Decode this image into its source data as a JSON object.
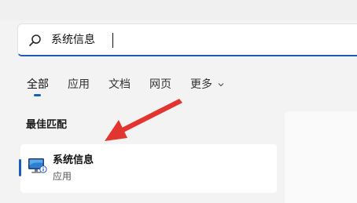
{
  "search": {
    "query": "系统信息",
    "icon": "search-icon"
  },
  "tabs": [
    {
      "label": "全部",
      "active": true
    },
    {
      "label": "应用"
    },
    {
      "label": "文档"
    },
    {
      "label": "网页"
    },
    {
      "label": "更多"
    }
  ],
  "best_match": {
    "title": "最佳匹配",
    "result": {
      "name": "系统信息",
      "type": "应用",
      "icon": "system-information-icon"
    }
  },
  "colors": {
    "accent": "#1a5fb4",
    "annotation_arrow": "#e2352f",
    "background": "#f3f3f3"
  }
}
